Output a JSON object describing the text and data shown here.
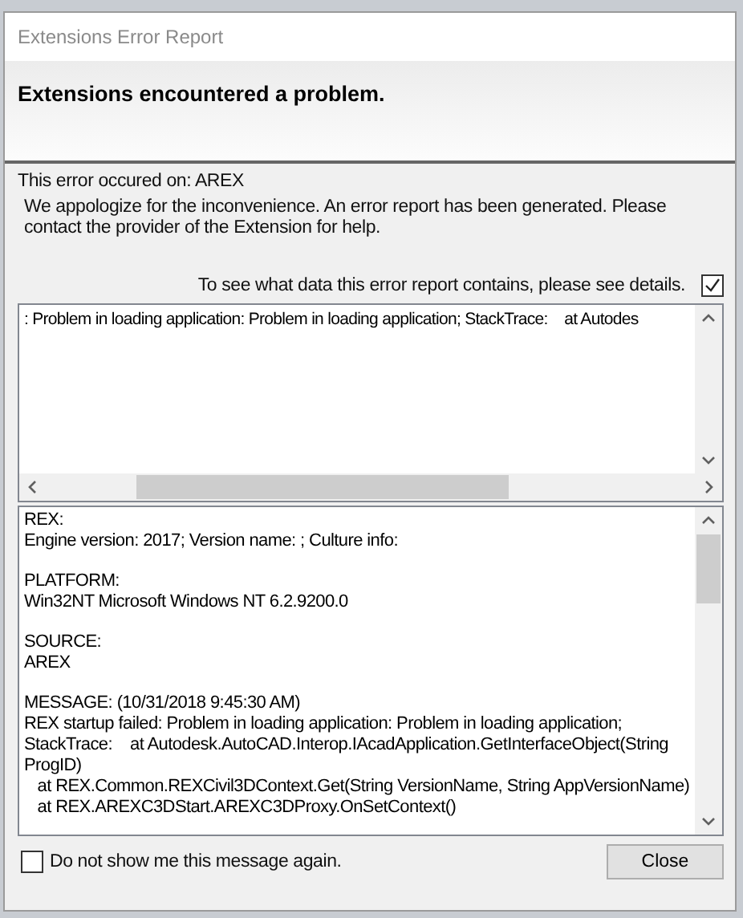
{
  "window": {
    "title": "Extensions Error Report"
  },
  "header": {
    "heading": "Extensions encountered a problem."
  },
  "error_source": "This error occured on: AREX",
  "apology": "We appologize for the inconvenience. An error report has been generated.  Please contact the provider of the Extension for help.",
  "details_toggle": {
    "label": "To see what data this error report contains, please see details.",
    "checked": true
  },
  "summary_log": {
    "text": ": Problem in loading application: Problem in loading application; StackTrace:    at Autodes"
  },
  "details_log": {
    "sections": [
      {
        "lines": [
          "REX:",
          "Engine version: 2017; Version name: ; Culture info:"
        ]
      },
      {
        "lines": [
          "PLATFORM:",
          "Win32NT Microsoft Windows NT 6.2.9200.0"
        ]
      },
      {
        "lines": [
          "SOURCE:",
          "AREX"
        ]
      },
      {
        "lines": [
          "MESSAGE: (10/31/2018 9:45:30 AM)",
          "REX startup failed: Problem in loading application: Problem in loading application;",
          "StackTrace:    at Autodesk.AutoCAD.Interop.IAcadApplication.GetInterfaceObject(String ProgID)",
          "   at REX.Common.REXCivil3DContext.Get(String VersionName, String AppVersionName)",
          "   at REX.AREXC3DStart.AREXC3DProxy.OnSetContext()"
        ]
      }
    ]
  },
  "footer": {
    "dont_show": {
      "label": "Do not show me this message again.",
      "checked": false
    },
    "close_button": "Close"
  }
}
